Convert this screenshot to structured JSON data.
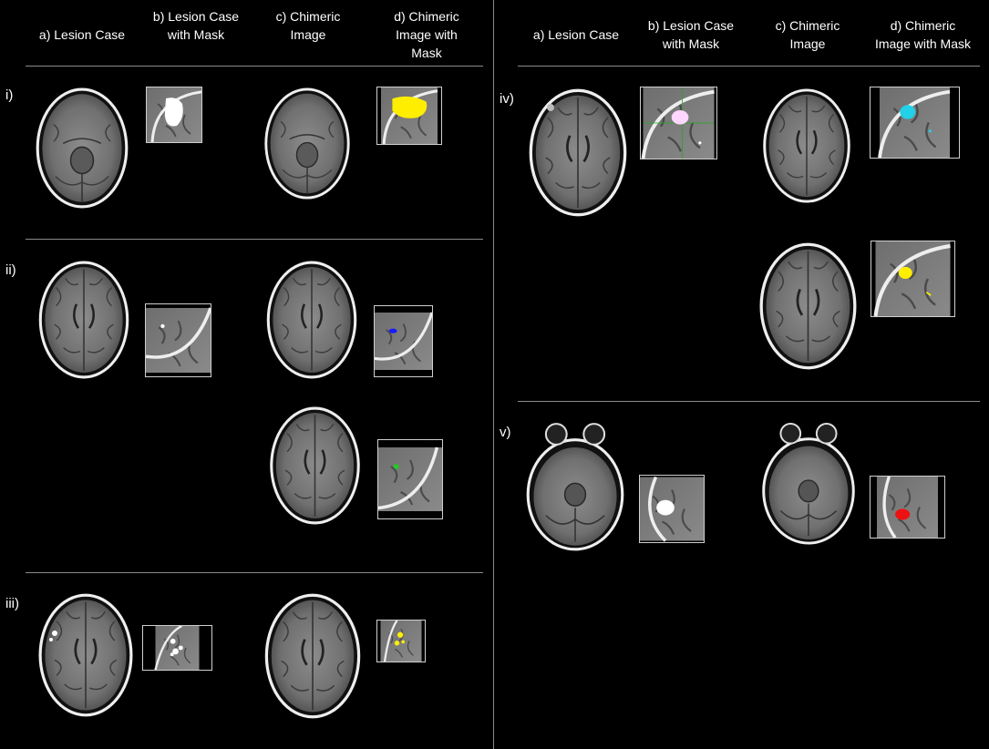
{
  "left_panel": {
    "headers": {
      "a": "a) Lesion Case",
      "b1": "b) Lesion Case",
      "b2": "with Mask",
      "c1": "c) Chimeric",
      "c2": "Image",
      "d1": "d) Chimeric",
      "d2": "Image with",
      "d3": "Mask"
    },
    "rows": [
      {
        "label": "i)"
      },
      {
        "label": "ii)"
      },
      {
        "label": "iii)"
      }
    ]
  },
  "right_panel": {
    "headers": {
      "a": "a) Lesion Case",
      "b1": "b) Lesion Case",
      "b2": "with Mask",
      "c1": "c) Chimeric",
      "c2": "Image",
      "d1": "d) Chimeric",
      "d2": "Image with Mask"
    },
    "rows": [
      {
        "label": "iv)"
      },
      {
        "label": "v)"
      }
    ]
  },
  "mask_colors": {
    "lesion": "#ffffff",
    "i": "#ffee00",
    "ii_a": "#1a1aff",
    "ii_b": "#22cc22",
    "iii": "#ffee00",
    "iv_a": "#22d0e8",
    "iv_b": "#ffee00",
    "v": "#ee1111"
  }
}
